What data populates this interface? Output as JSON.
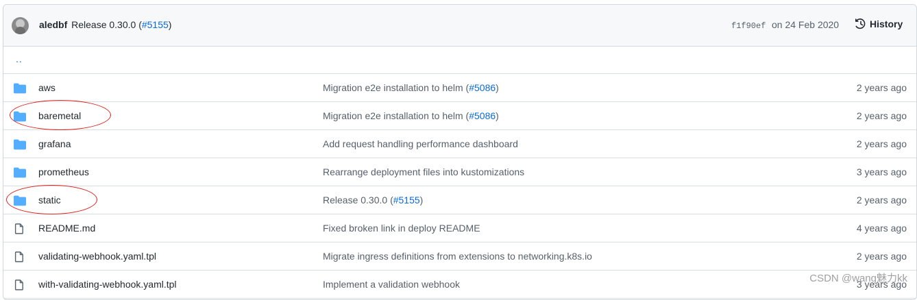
{
  "commit": {
    "author": "aledbf",
    "message": "Release 0.30.0 (",
    "pr": "#5155",
    "message_end": ")",
    "sha": "f1f90ef",
    "date": "on 24 Feb 2020",
    "history_label": "History"
  },
  "parent_link": "..",
  "rows": [
    {
      "type": "dir",
      "name": "aws",
      "msg": "Migration e2e installation to helm (",
      "pr": "#5086",
      "msg_end": ")",
      "age": "2 years ago"
    },
    {
      "type": "dir",
      "name": "baremetal",
      "msg": "Migration e2e installation to helm (",
      "pr": "#5086",
      "msg_end": ")",
      "age": "2 years ago"
    },
    {
      "type": "dir",
      "name": "grafana",
      "msg": "Add request handling performance dashboard",
      "pr": "",
      "msg_end": "",
      "age": "2 years ago"
    },
    {
      "type": "dir",
      "name": "prometheus",
      "msg": "Rearrange deployment files into kustomizations",
      "pr": "",
      "msg_end": "",
      "age": "3 years ago"
    },
    {
      "type": "dir",
      "name": "static",
      "msg": "Release 0.30.0 (",
      "pr": "#5155",
      "msg_end": ")",
      "age": "2 years ago"
    },
    {
      "type": "file",
      "name": "README.md",
      "msg": "Fixed broken link in deploy README",
      "pr": "",
      "msg_end": "",
      "age": "4 years ago"
    },
    {
      "type": "file",
      "name": "validating-webhook.yaml.tpl",
      "msg": "Migrate ingress definitions from extensions to networking.k8s.io",
      "pr": "",
      "msg_end": "",
      "age": "2 years ago"
    },
    {
      "type": "file",
      "name": "with-validating-webhook.yaml.tpl",
      "msg": "Implement a validation webhook",
      "pr": "",
      "msg_end": "",
      "age": "3 years ago"
    }
  ],
  "colors": {
    "folder": "#54aeff",
    "file": "#57606a",
    "link": "#0969da",
    "annotation": "#e0221c"
  },
  "watermark": "CSDN @wang魅力kk"
}
